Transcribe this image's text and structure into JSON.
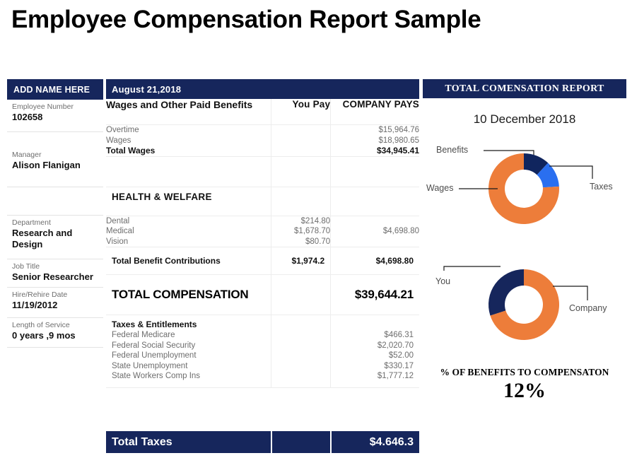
{
  "page_title": "Employee Compensation Report Sample",
  "colors": {
    "navy": "#16265c",
    "orange": "#ed7d3a",
    "blue": "#2a6ff0",
    "dark_navy": "#10255e"
  },
  "sidebar": {
    "header": "ADD NAME HERE",
    "fields": [
      {
        "label": "Employee  Number",
        "value": "102658"
      },
      {
        "label": "Manager",
        "value": "Alison  Flanigan"
      },
      {
        "label": "Department",
        "value": "Research and Design"
      },
      {
        "label": "Job Title",
        "value": "Senior Researcher"
      },
      {
        "label": "Hire/Rehire Date",
        "value": "11/19/2012"
      },
      {
        "label": "Length of Service",
        "value": "0 years ,9 mos"
      }
    ]
  },
  "table": {
    "date_bar": "August 21,2018",
    "columns": {
      "description": "Wages and Other Paid Benefits",
      "you_pay": "You Pay",
      "company_pays": "COMPANY  PAYS"
    },
    "wages": {
      "items": [
        {
          "label": "Overtime",
          "company": "$15,964.76"
        },
        {
          "label": "Wages",
          "company": "$18,980.65"
        }
      ],
      "total_label": "Total Wages",
      "total_company": "$34,945.41"
    },
    "health_welfare": {
      "section_title": "HEALTH  & WELFARE",
      "items": [
        {
          "label": "Dental",
          "you": "$214.80"
        },
        {
          "label": "Medical",
          "you": "$1,678.70"
        },
        {
          "label": "Vision",
          "you": "$80.70"
        }
      ],
      "company_combined": "$4,698.80",
      "total_label": "Total Benefit Contributions",
      "total_you": "$1,974.2",
      "total_company": "$4,698.80"
    },
    "total_compensation": {
      "label": "TOTAL COMPENSATION",
      "amount": "$39,644.21"
    },
    "taxes": {
      "section_title": "Taxes & Entitlements",
      "items": [
        {
          "label": "Federal Medicare",
          "company": "$466.31"
        },
        {
          "label": "Federal Social Security",
          "company": "$2,020.70"
        },
        {
          "label": "Federal Unemployment",
          "company": "$52.00"
        },
        {
          "label": "State Unemployment",
          "company": "$330.17"
        },
        {
          "label": "State Workers Comp Ins",
          "company": "$1,777.12"
        }
      ]
    },
    "total_taxes": {
      "label": "Total Taxes",
      "amount": "$4.646.3"
    }
  },
  "right_panel": {
    "header": "TOTAL COMENSATION REPORT",
    "report_date": "10 December 2018",
    "pct_caption": "% OF BENEFITS TO COMPENSATON",
    "pct_value": "12%"
  },
  "chart_data": [
    {
      "type": "pie",
      "variant": "donut",
      "title": "",
      "categories": [
        "Benefits",
        "Taxes",
        "Wages"
      ],
      "values": [
        12,
        12,
        76
      ],
      "colors": [
        "#10255e",
        "#2a6ff0",
        "#ed7d3a"
      ],
      "labels": [
        "Benefits",
        "Taxes",
        "Wages"
      ],
      "legend": "callout-leader-lines",
      "start_angle": 0
    },
    {
      "type": "pie",
      "variant": "donut",
      "title": "",
      "categories": [
        "Company",
        "You"
      ],
      "values": [
        70,
        30
      ],
      "colors": [
        "#ed7d3a",
        "#16265c"
      ],
      "labels": [
        "Company",
        "You"
      ],
      "legend": "callout-leader-lines",
      "start_angle": 0
    }
  ]
}
